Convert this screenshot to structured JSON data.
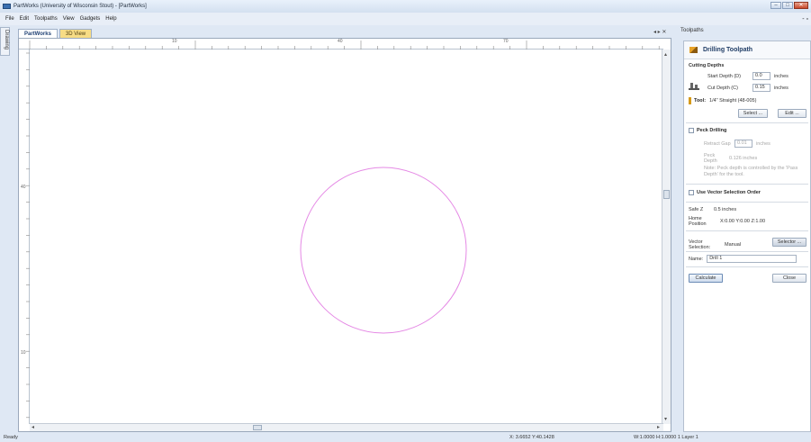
{
  "window": {
    "title": "PartWorks (University of Wisconsin Stout) - [PartWorks]",
    "buttons": [
      "–",
      "□",
      "✕"
    ]
  },
  "menu": {
    "items": [
      "File",
      "Edit",
      "Toolpaths",
      "View",
      "Gadgets",
      "Help"
    ],
    "pin": "- ▫"
  },
  "side_tab": {
    "label": "Drawing"
  },
  "doc_tabs": [
    {
      "label": "PartWorks"
    },
    {
      "label": "3D View"
    }
  ],
  "tab_controls": "◂ ▸ ✕",
  "rulers": {
    "h_labels": [
      "10",
      "40",
      "70"
    ],
    "v_labels": [
      "40",
      "10"
    ]
  },
  "drawing": {
    "circle_color": "#e589e5"
  },
  "panel": {
    "header": "Toolpaths",
    "title": "Drilling Toolpath",
    "cutting_depths": "Cutting Depths",
    "start_depth_label": "Start Depth (D)",
    "start_depth_value": "0.0",
    "cut_depth_label": "Cut Depth (C)",
    "cut_depth_value": "0.15",
    "units": "inches",
    "tool_label": "Tool:",
    "tool_value": "1/4\" Straight (48-005)",
    "select_button": "Select ...",
    "edit_button": "Edit ...",
    "peck_drilling": "Peck Drilling",
    "retract_gap_label": "Retract Gap",
    "retract_gap_value": "0.01",
    "peck_depth_label": "Peck Depth",
    "peck_depth_value": "0.126 inches",
    "peck_note": "Note: Peck depth is controlled by the 'Pass Depth' for the tool.",
    "vector_order": "Use Vector Selection Order",
    "safe_z_label": "Safe Z",
    "safe_z_value": "0.5 inches",
    "home_label": "Home Position",
    "home_value": "X:0.00 Y:0.00 Z:1.00",
    "vector_selection_label": "Vector Selection:",
    "vector_selection_value": "Manual",
    "selector_button": "Selector ...",
    "name_label": "Name:",
    "name_value": "Drill 1",
    "calculate_button": "Calculate",
    "close_button": "Close"
  },
  "status": {
    "left": "Ready",
    "coords": "X: 3.6652 Y:40.1428",
    "size": "W:1.0000  H:1.0000  1 Layer 1"
  }
}
